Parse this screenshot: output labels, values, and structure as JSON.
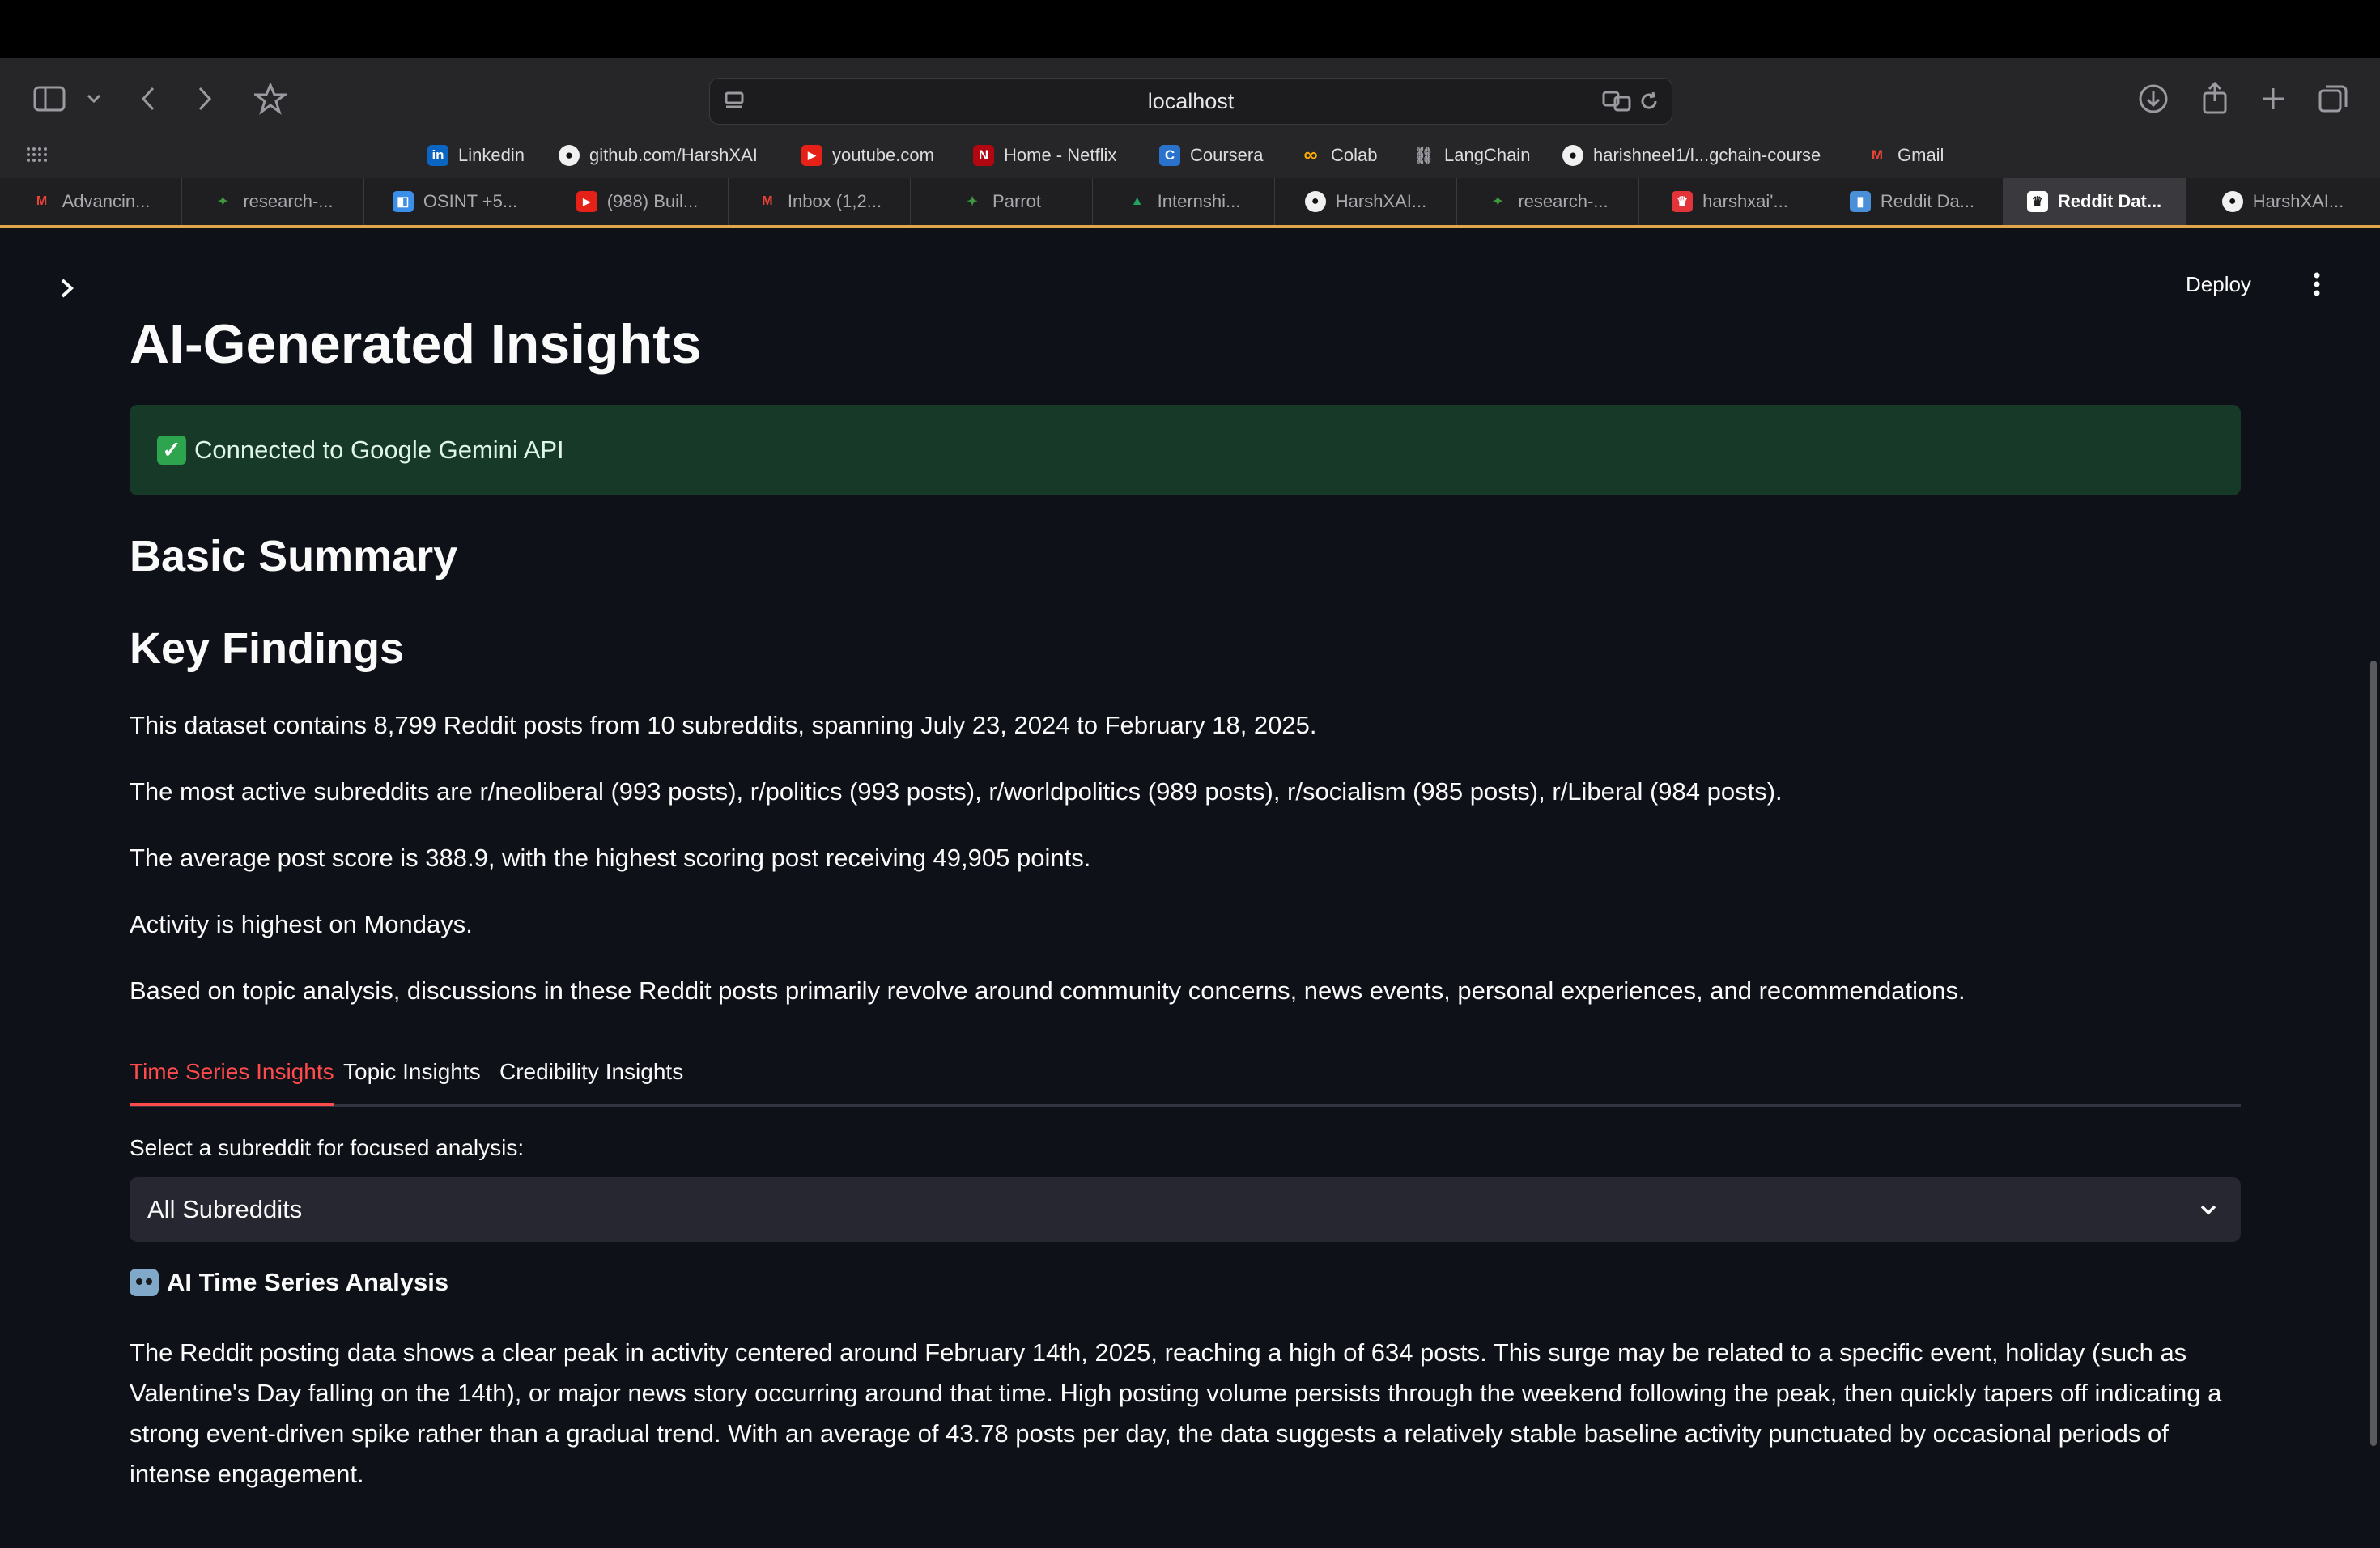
{
  "browser": {
    "url": "localhost",
    "bookmarks": [
      {
        "label": "Linkedin",
        "icon": "linkedin-icon",
        "color": "#0a66c2",
        "glyph": "in"
      },
      {
        "label": "github.com/HarshXAI",
        "icon": "github-icon",
        "color": "#f0f0f0",
        "glyph": "●"
      },
      {
        "label": "youtube.com",
        "icon": "youtube-icon",
        "color": "#e62117",
        "glyph": "▶"
      },
      {
        "label": "Home - Netflix",
        "icon": "netflix-icon",
        "color": "#b20710",
        "glyph": "N"
      },
      {
        "label": "Coursera",
        "icon": "coursera-icon",
        "color": "#2a73cc",
        "glyph": "C"
      },
      {
        "label": "Colab",
        "icon": "colab-icon",
        "color": "#f9ab00",
        "glyph": "∞"
      },
      {
        "label": "LangChain",
        "icon": "link-icon",
        "color": "#777777",
        "glyph": "🔗"
      },
      {
        "label": "harishneel1/l...gchain-course",
        "icon": "github-icon",
        "color": "#f0f0f0",
        "glyph": "●"
      },
      {
        "label": "Gmail",
        "icon": "gmail-icon",
        "color": "#ea4335",
        "glyph": "M"
      }
    ],
    "tabs": [
      {
        "label": "Advancin...",
        "icon": "gmail-icon",
        "color": "#ea4335",
        "glyph": "M"
      },
      {
        "label": "research-...",
        "icon": "parrot-icon",
        "color": "#3d9a3d",
        "glyph": "🦜"
      },
      {
        "label": "OSINT +5...",
        "icon": "app-icon",
        "color": "#3b8fe8",
        "glyph": "◧"
      },
      {
        "label": "(988) Buil...",
        "icon": "youtube-icon",
        "color": "#e62117",
        "glyph": "▶"
      },
      {
        "label": "Inbox (1,2...",
        "icon": "gmail-icon",
        "color": "#ea4335",
        "glyph": "M"
      },
      {
        "label": "Parrot",
        "icon": "parrot-icon",
        "color": "#3d9a3d",
        "glyph": "🦜"
      },
      {
        "label": "Internshi...",
        "icon": "drive-icon",
        "color": "#1fa463",
        "glyph": "▲"
      },
      {
        "label": "HarshXAI...",
        "icon": "github-icon",
        "color": "#f0f0f0",
        "glyph": "●"
      },
      {
        "label": "research-...",
        "icon": "parrot-icon",
        "color": "#3d9a3d",
        "glyph": "🦜"
      },
      {
        "label": "harshxai'...",
        "icon": "crown-icon",
        "color": "#e3343a",
        "glyph": "♛"
      },
      {
        "label": "Reddit Da...",
        "icon": "chart-icon",
        "color": "#4a90d9",
        "glyph": "▮"
      },
      {
        "label": "Reddit Dat...",
        "icon": "crown-icon",
        "color": "#ffffff",
        "glyph": "♛",
        "active": true
      },
      {
        "label": "HarshXAI...",
        "icon": "github-icon",
        "color": "#f0f0f0",
        "glyph": "●"
      }
    ]
  },
  "app": {
    "deploy_label": "Deploy",
    "title": "AI-Generated Insights",
    "status": "Connected to Google Gemini API",
    "basic_summary": "Basic Summary",
    "key_findings": "Key Findings",
    "findings": [
      "This dataset contains 8,799 Reddit posts from 10 subreddits, spanning July 23, 2024 to February 18, 2025.",
      "The most active subreddits are r/neoliberal (993 posts), r/politics (993 posts), r/worldpolitics (989 posts), r/socialism (985 posts), r/Liberal (984 posts).",
      "The average post score is 388.9, with the highest scoring post receiving 49,905 points.",
      "Activity is highest on Mondays.",
      "Based on topic analysis, discussions in these Reddit posts primarily revolve around community concerns, news events, personal experiences, and recommendations."
    ],
    "tabs": [
      "Time Series Insights",
      "Topic Insights",
      "Credibility Insights"
    ],
    "select_label": "Select a subreddit for focused analysis:",
    "select_value": "All Subreddits",
    "analysis_title": "AI Time Series Analysis",
    "analysis_text": "The Reddit posting data shows a clear peak in activity centered around February 14th, 2025, reaching a high of 634 posts. This surge may be related to a specific event, holiday (such as Valentine's Day falling on the 14th), or major news story occurring around that time. High posting volume persists through the weekend following the peak, then quickly tapers off indicating a strong event-driven spike rather than a gradual trend. With an average of 43.78 posts per day, the data suggests a relatively stable baseline activity punctuated by occasional periods of intense engagement."
  },
  "colors": {
    "accent": "#ff4b4b",
    "success_bg": "#173928",
    "background": "#0e1117"
  }
}
